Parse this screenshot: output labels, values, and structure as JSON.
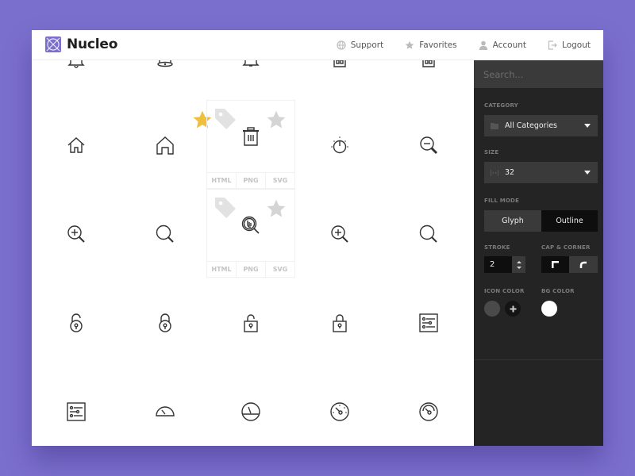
{
  "app": {
    "name": "Nucleo",
    "brand_color": "#7b6fce"
  },
  "nav": {
    "items": [
      {
        "label": "Support",
        "icon": "globe-icon"
      },
      {
        "label": "Favorites",
        "icon": "star-icon"
      },
      {
        "label": "Account",
        "icon": "user-icon"
      },
      {
        "label": "Logout",
        "icon": "logout-icon"
      }
    ]
  },
  "grid": {
    "rows": [
      [
        "bell",
        "bell-ringing",
        "bell-alt",
        "home-alt",
        "home-alt"
      ],
      [
        "home",
        "home-large",
        "trash",
        "stopwatch",
        "zoom-out"
      ],
      [
        "zoom-in",
        "search",
        "search-hand",
        "zoom-in",
        "search"
      ],
      [
        "lock-open",
        "lock-round",
        "lock-open-square",
        "lock-square",
        "settings-sliders"
      ],
      [
        "settings-sliders",
        "gauge-half",
        "gauge-circle",
        "speedometer",
        "speedometer-alt"
      ]
    ],
    "favorite_star_color": "#f0c03c",
    "card_actions": [
      "HTML",
      "PNG",
      "SVG"
    ]
  },
  "sidebar": {
    "search": {
      "placeholder": "Search...",
      "value": ""
    },
    "category": {
      "label": "CATEGORY",
      "value": "All Categories"
    },
    "size": {
      "label": "SIZE",
      "value": "32"
    },
    "fill_mode": {
      "label": "FILL MODE",
      "options": [
        "Glyph",
        "Outline"
      ],
      "selected": "Outline"
    },
    "stroke": {
      "label": "STROKE",
      "value": "2"
    },
    "cap_corner": {
      "label": "CAP & CORNER",
      "options": [
        "square",
        "round"
      ],
      "selected": "square"
    },
    "icon_color": {
      "label": "ICON COLOR",
      "value": "#4a4a4a"
    },
    "bg_color": {
      "label": "BG COLOR",
      "value": "#ffffff"
    }
  }
}
